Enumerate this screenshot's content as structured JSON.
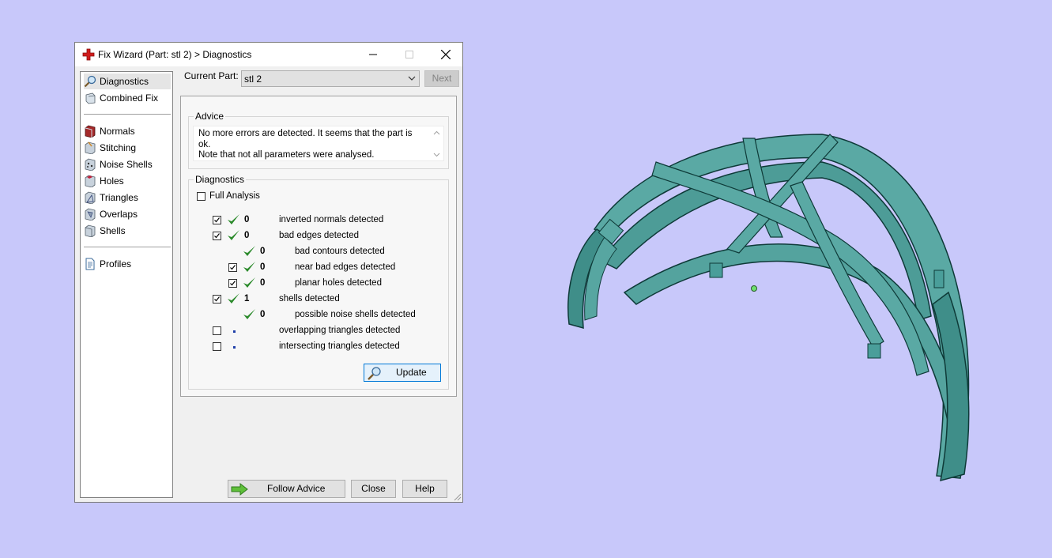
{
  "window": {
    "title": "Fix Wizard (Part: stl 2) > Diagnostics"
  },
  "sidebar": {
    "items": [
      {
        "label": "Diagnostics",
        "icon": "magnifier-icon"
      },
      {
        "label": "Combined Fix",
        "icon": "combined-fix-icon"
      },
      {
        "label": "Normals",
        "icon": "normals-icon"
      },
      {
        "label": "Stitching",
        "icon": "stitching-icon"
      },
      {
        "label": "Noise Shells",
        "icon": "noise-shells-icon"
      },
      {
        "label": "Holes",
        "icon": "holes-icon"
      },
      {
        "label": "Triangles",
        "icon": "triangles-icon"
      },
      {
        "label": "Overlaps",
        "icon": "overlaps-icon"
      },
      {
        "label": "Shells",
        "icon": "shells-icon"
      },
      {
        "label": "Profiles",
        "icon": "profiles-icon"
      }
    ],
    "selected": "Diagnostics"
  },
  "part": {
    "label": "Current Part:",
    "value": "stl 2",
    "next_label": "Next"
  },
  "advice": {
    "title": "Advice",
    "line1": "No more errors are detected. It seems that the part is ok.",
    "line2": "Note that not all parameters were analysed."
  },
  "diagnostics": {
    "title": "Diagnostics",
    "full_analysis_label": "Full Analysis",
    "full_analysis_checked": false,
    "rows": [
      {
        "checked": true,
        "status": "ok",
        "count": "0",
        "label": "inverted normals detected"
      },
      {
        "checked": true,
        "status": "ok",
        "count": "0",
        "label": "bad edges detected"
      },
      {
        "checked": null,
        "status": "ok",
        "count": "0",
        "label": "bad contours detected"
      },
      {
        "checked": true,
        "status": "ok",
        "count": "0",
        "label": "near bad edges detected"
      },
      {
        "checked": true,
        "status": "ok",
        "count": "0",
        "label": "planar holes detected"
      },
      {
        "checked": true,
        "status": "ok",
        "count": "1",
        "label": "shells detected"
      },
      {
        "checked": null,
        "status": "ok",
        "count": "0",
        "label": "possible noise shells detected"
      },
      {
        "checked": false,
        "status": "not-analysed",
        "count": "",
        "label": "overlapping triangles detected"
      },
      {
        "checked": false,
        "status": "not-analysed",
        "count": "",
        "label": "intersecting triangles detected"
      }
    ],
    "update_label": "Update"
  },
  "footer": {
    "follow_advice_label": "Follow Advice",
    "close_label": "Close",
    "help_label": "Help"
  },
  "colors": {
    "desktop": "#c8c8fa",
    "model": "#4a9e9a",
    "check_green": "#2b8a2b",
    "accent": "#0078d7"
  }
}
